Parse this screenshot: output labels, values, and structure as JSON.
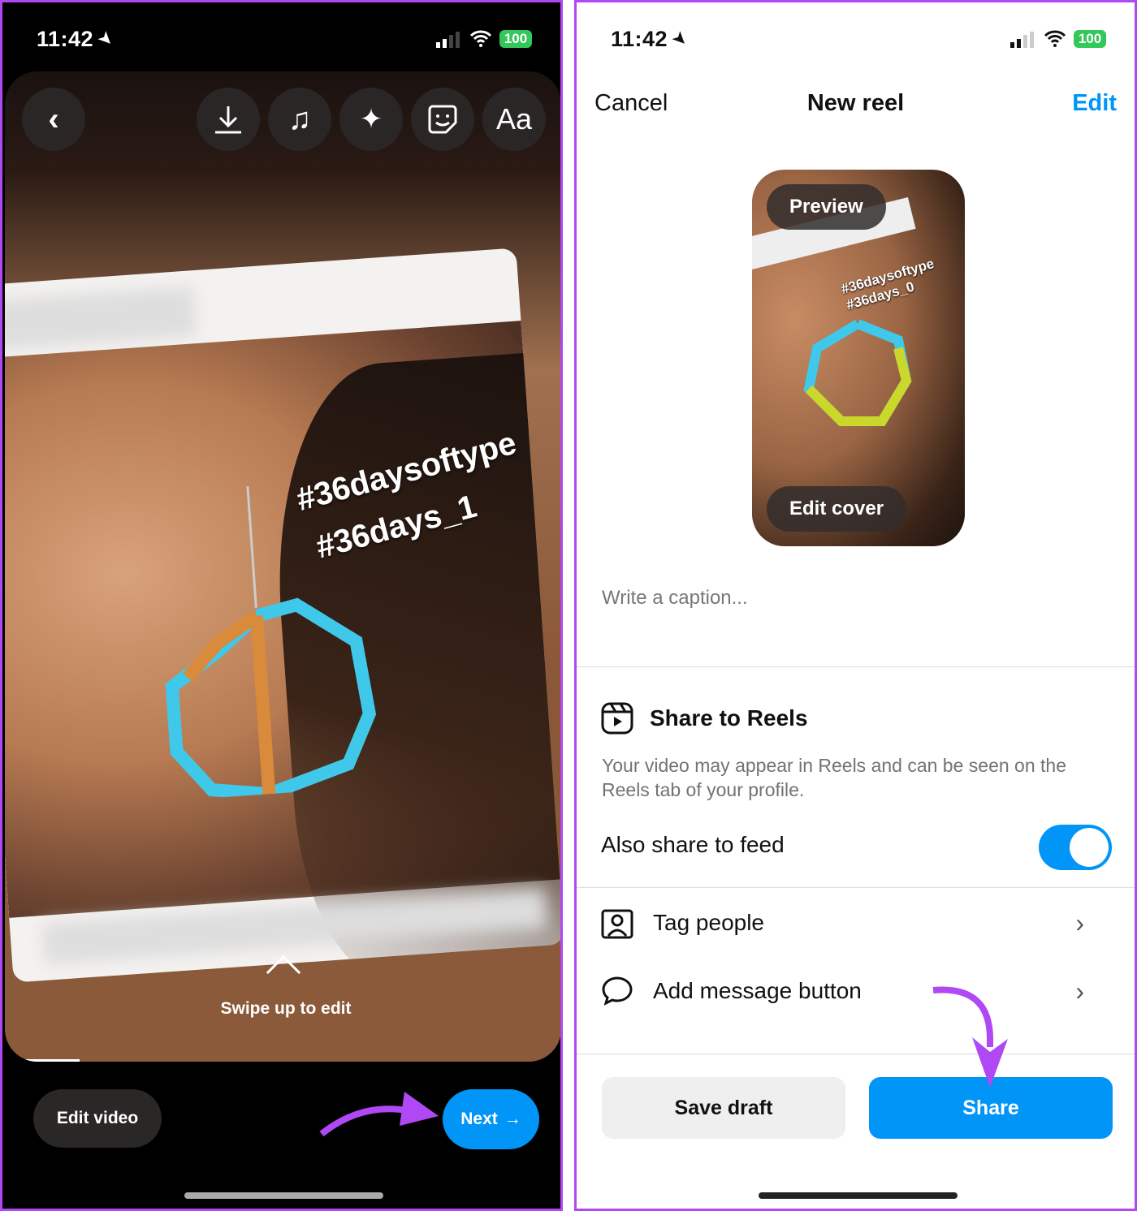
{
  "left": {
    "status": {
      "time": "11:42",
      "battery": "100"
    },
    "toolbar": {
      "icons": [
        "back-chevron-icon",
        "download-icon",
        "music-note-icon",
        "sparkles-icon",
        "sticker-icon",
        "text-aa-icon"
      ],
      "text_label": "Aa"
    },
    "photo": {
      "hashtag_1": "#36daysoftype",
      "hashtag_2": "#36days_1"
    },
    "swipe_hint": "Swipe up to edit",
    "edit_video": "Edit video",
    "next": "Next",
    "next_arrow": "→"
  },
  "right": {
    "status": {
      "time": "11:42",
      "battery": "100"
    },
    "header": {
      "cancel": "Cancel",
      "title": "New reel",
      "edit": "Edit"
    },
    "cover": {
      "preview": "Preview",
      "edit_cover": "Edit cover",
      "hashtag_1": "#36daysoftype",
      "hashtag_2": "#36days_0"
    },
    "caption_placeholder": "Write a caption...",
    "share_to_reels": {
      "title": "Share to Reels",
      "description": "Your video may appear in Reels and can be seen on the Reels tab of your profile."
    },
    "also_share_to_feed": {
      "label": "Also share to feed",
      "on": true
    },
    "rows": [
      {
        "label": "Tag people",
        "icon": "tag-person-icon"
      },
      {
        "label": "Add message button",
        "icon": "chat-bubble-icon"
      }
    ],
    "save_draft": "Save draft",
    "share": "Share"
  },
  "colors": {
    "accent": "#0095f6",
    "annotation": "#b048f5",
    "toggle_on": "#0095f6",
    "battery": "#34c759"
  }
}
